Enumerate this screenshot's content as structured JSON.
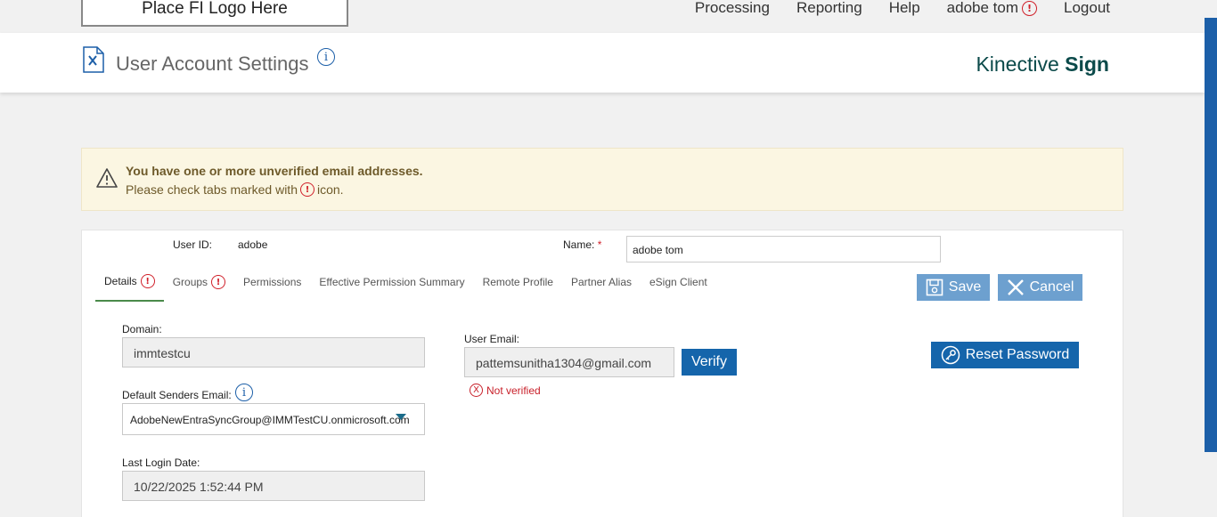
{
  "topbar": {
    "logo_text": "Place FI Logo Here",
    "nav": {
      "processing": "Processing",
      "reporting": "Reporting",
      "help": "Help",
      "user": "adobe tom",
      "logout": "Logout"
    }
  },
  "header": {
    "title": "User Account Settings",
    "brand_light": "Kinective",
    "brand_bold": "Sign"
  },
  "alert": {
    "line1": "You have one or more unverified email addresses.",
    "line2_before": "Please check tabs marked with",
    "line2_after": "icon."
  },
  "user": {
    "user_id_label": "User ID:",
    "user_id": "adobe",
    "name_label": "Name:",
    "required_mark": "*",
    "name_value": "adobe tom"
  },
  "tabs": [
    {
      "label": "Details",
      "warn": true,
      "active": true
    },
    {
      "label": "Groups",
      "warn": true,
      "active": false
    },
    {
      "label": "Permissions",
      "warn": false,
      "active": false
    },
    {
      "label": "Effective Permission Summary",
      "warn": false,
      "active": false
    },
    {
      "label": "Remote Profile",
      "warn": false,
      "active": false
    },
    {
      "label": "Partner Alias",
      "warn": false,
      "active": false
    },
    {
      "label": "eSign Client",
      "warn": false,
      "active": false
    }
  ],
  "actions": {
    "save": "Save",
    "cancel": "Cancel",
    "reset_password": "Reset Password",
    "verify": "Verify"
  },
  "details": {
    "domain_label": "Domain:",
    "domain_value": "immtestcu",
    "default_senders_label": "Default Senders Email:",
    "default_senders_value": "AdobeNewEntraSyncGroup@IMMTestCU.onmicrosoft.com",
    "last_login_label": "Last Login Date:",
    "last_login_value": "10/22/2025 1:52:44 PM",
    "user_email_label": "User Email:",
    "user_email_value": "pattemsunitha1304@gmail.com",
    "not_verified": "Not verified"
  },
  "glyphs": {
    "warn": "!",
    "info": "i",
    "x": "X"
  },
  "colors": {
    "primary_blue": "#1565ab",
    "light_blue_button": "#6da0cf",
    "error_red": "#d0202a",
    "alert_bg": "#fbf6e2",
    "brand_teal": "#0b4a4a"
  }
}
